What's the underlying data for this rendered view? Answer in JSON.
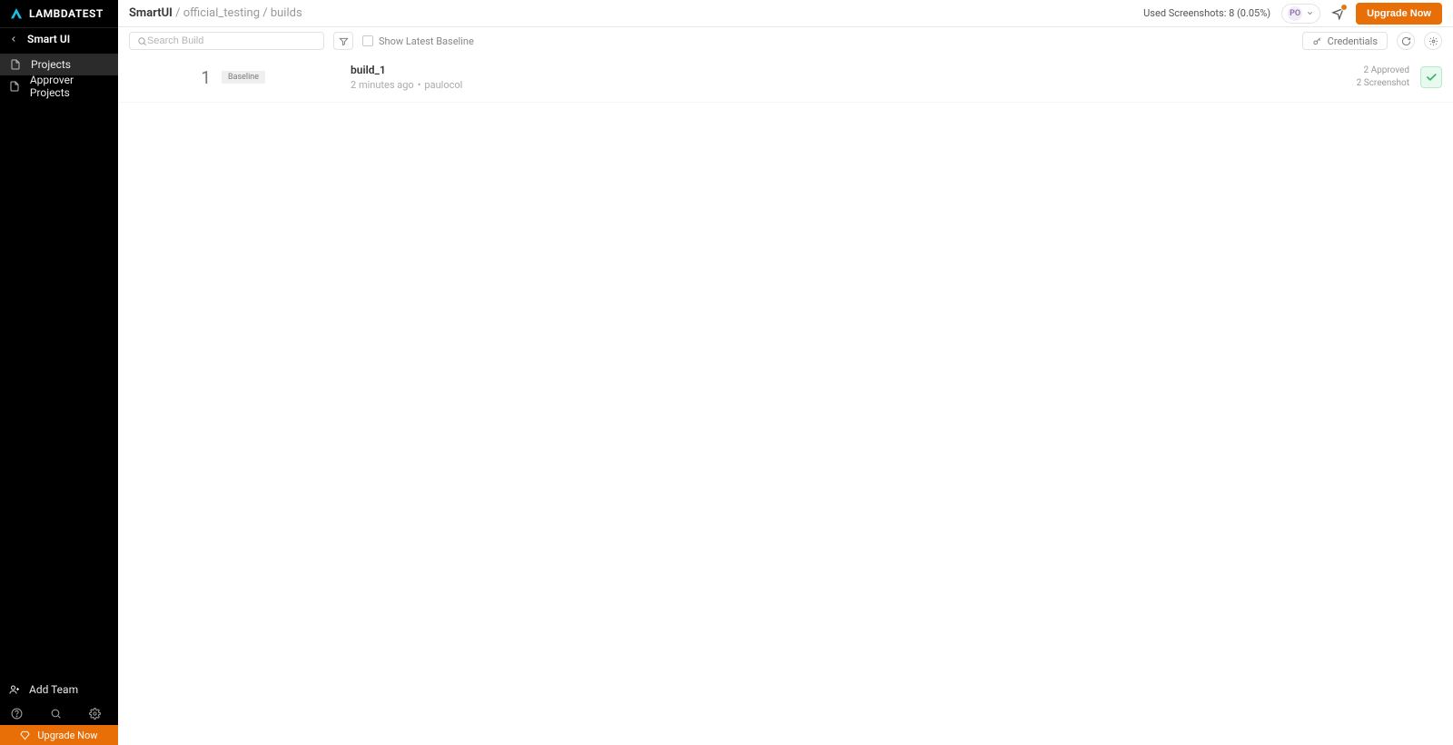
{
  "brand": {
    "name": "LAMBDATEST"
  },
  "sidebar": {
    "title": "Smart UI",
    "nav": [
      {
        "label": "Projects"
      },
      {
        "label": "Approver Projects"
      }
    ],
    "add_team_label": "Add Team",
    "upgrade_label": "Upgrade Now"
  },
  "breadcrumbs": {
    "root": "SmartUI",
    "sep1": " / ",
    "project": "official_testing",
    "sep2": " / ",
    "leaf": "builds"
  },
  "header": {
    "usage_text": "Used Screenshots: 8 (0.05%)",
    "avatar_initials": "PO",
    "upgrade_label": "Upgrade Now"
  },
  "toolbar": {
    "search_placeholder": "Search Build",
    "baseline_label": "Show Latest Baseline",
    "credentials_label": "Credentials"
  },
  "builds": [
    {
      "index": "1",
      "tag": "Baseline",
      "name": "build_1",
      "time": "2 minutes ago",
      "author": "paulocol",
      "approved_text": "2 Approved",
      "screenshot_text": "2 Screenshot"
    }
  ]
}
